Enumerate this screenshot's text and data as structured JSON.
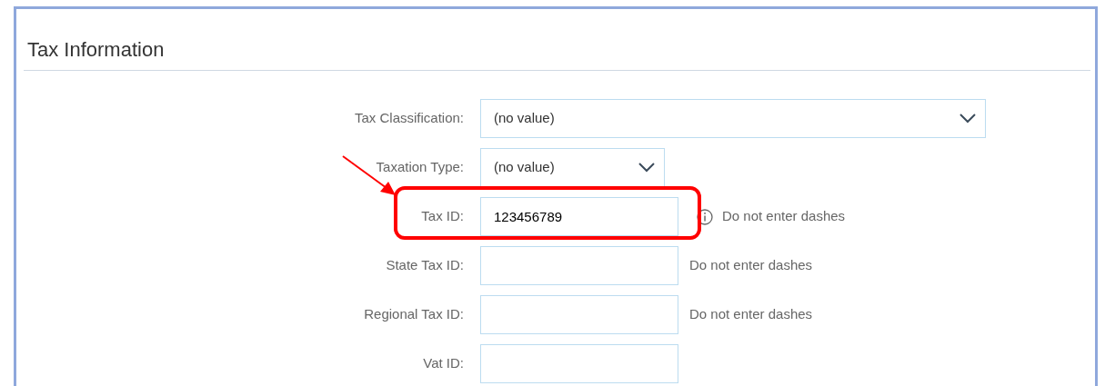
{
  "section": {
    "title": "Tax Information"
  },
  "fields": [
    {
      "label": "Tax Classification:",
      "kind": "dropdown",
      "value": "(no value)",
      "highlighted": false,
      "info": false
    },
    {
      "label": "Taxation Type:",
      "kind": "dropdown",
      "value": "(no value)",
      "highlighted": false,
      "info": false
    },
    {
      "label": "Tax ID:",
      "kind": "text",
      "value": "123456789",
      "hint": "Do not enter dashes",
      "highlighted": true,
      "info": true
    },
    {
      "label": "State Tax ID:",
      "kind": "text",
      "hint": "Do not enter dashes",
      "highlighted": false,
      "info": false
    },
    {
      "label": "Regional Tax ID:",
      "kind": "text",
      "hint": "Do not enter dashes",
      "highlighted": false,
      "info": false
    },
    {
      "label": "Vat ID:",
      "kind": "text",
      "highlighted": false,
      "info": false
    }
  ]
}
